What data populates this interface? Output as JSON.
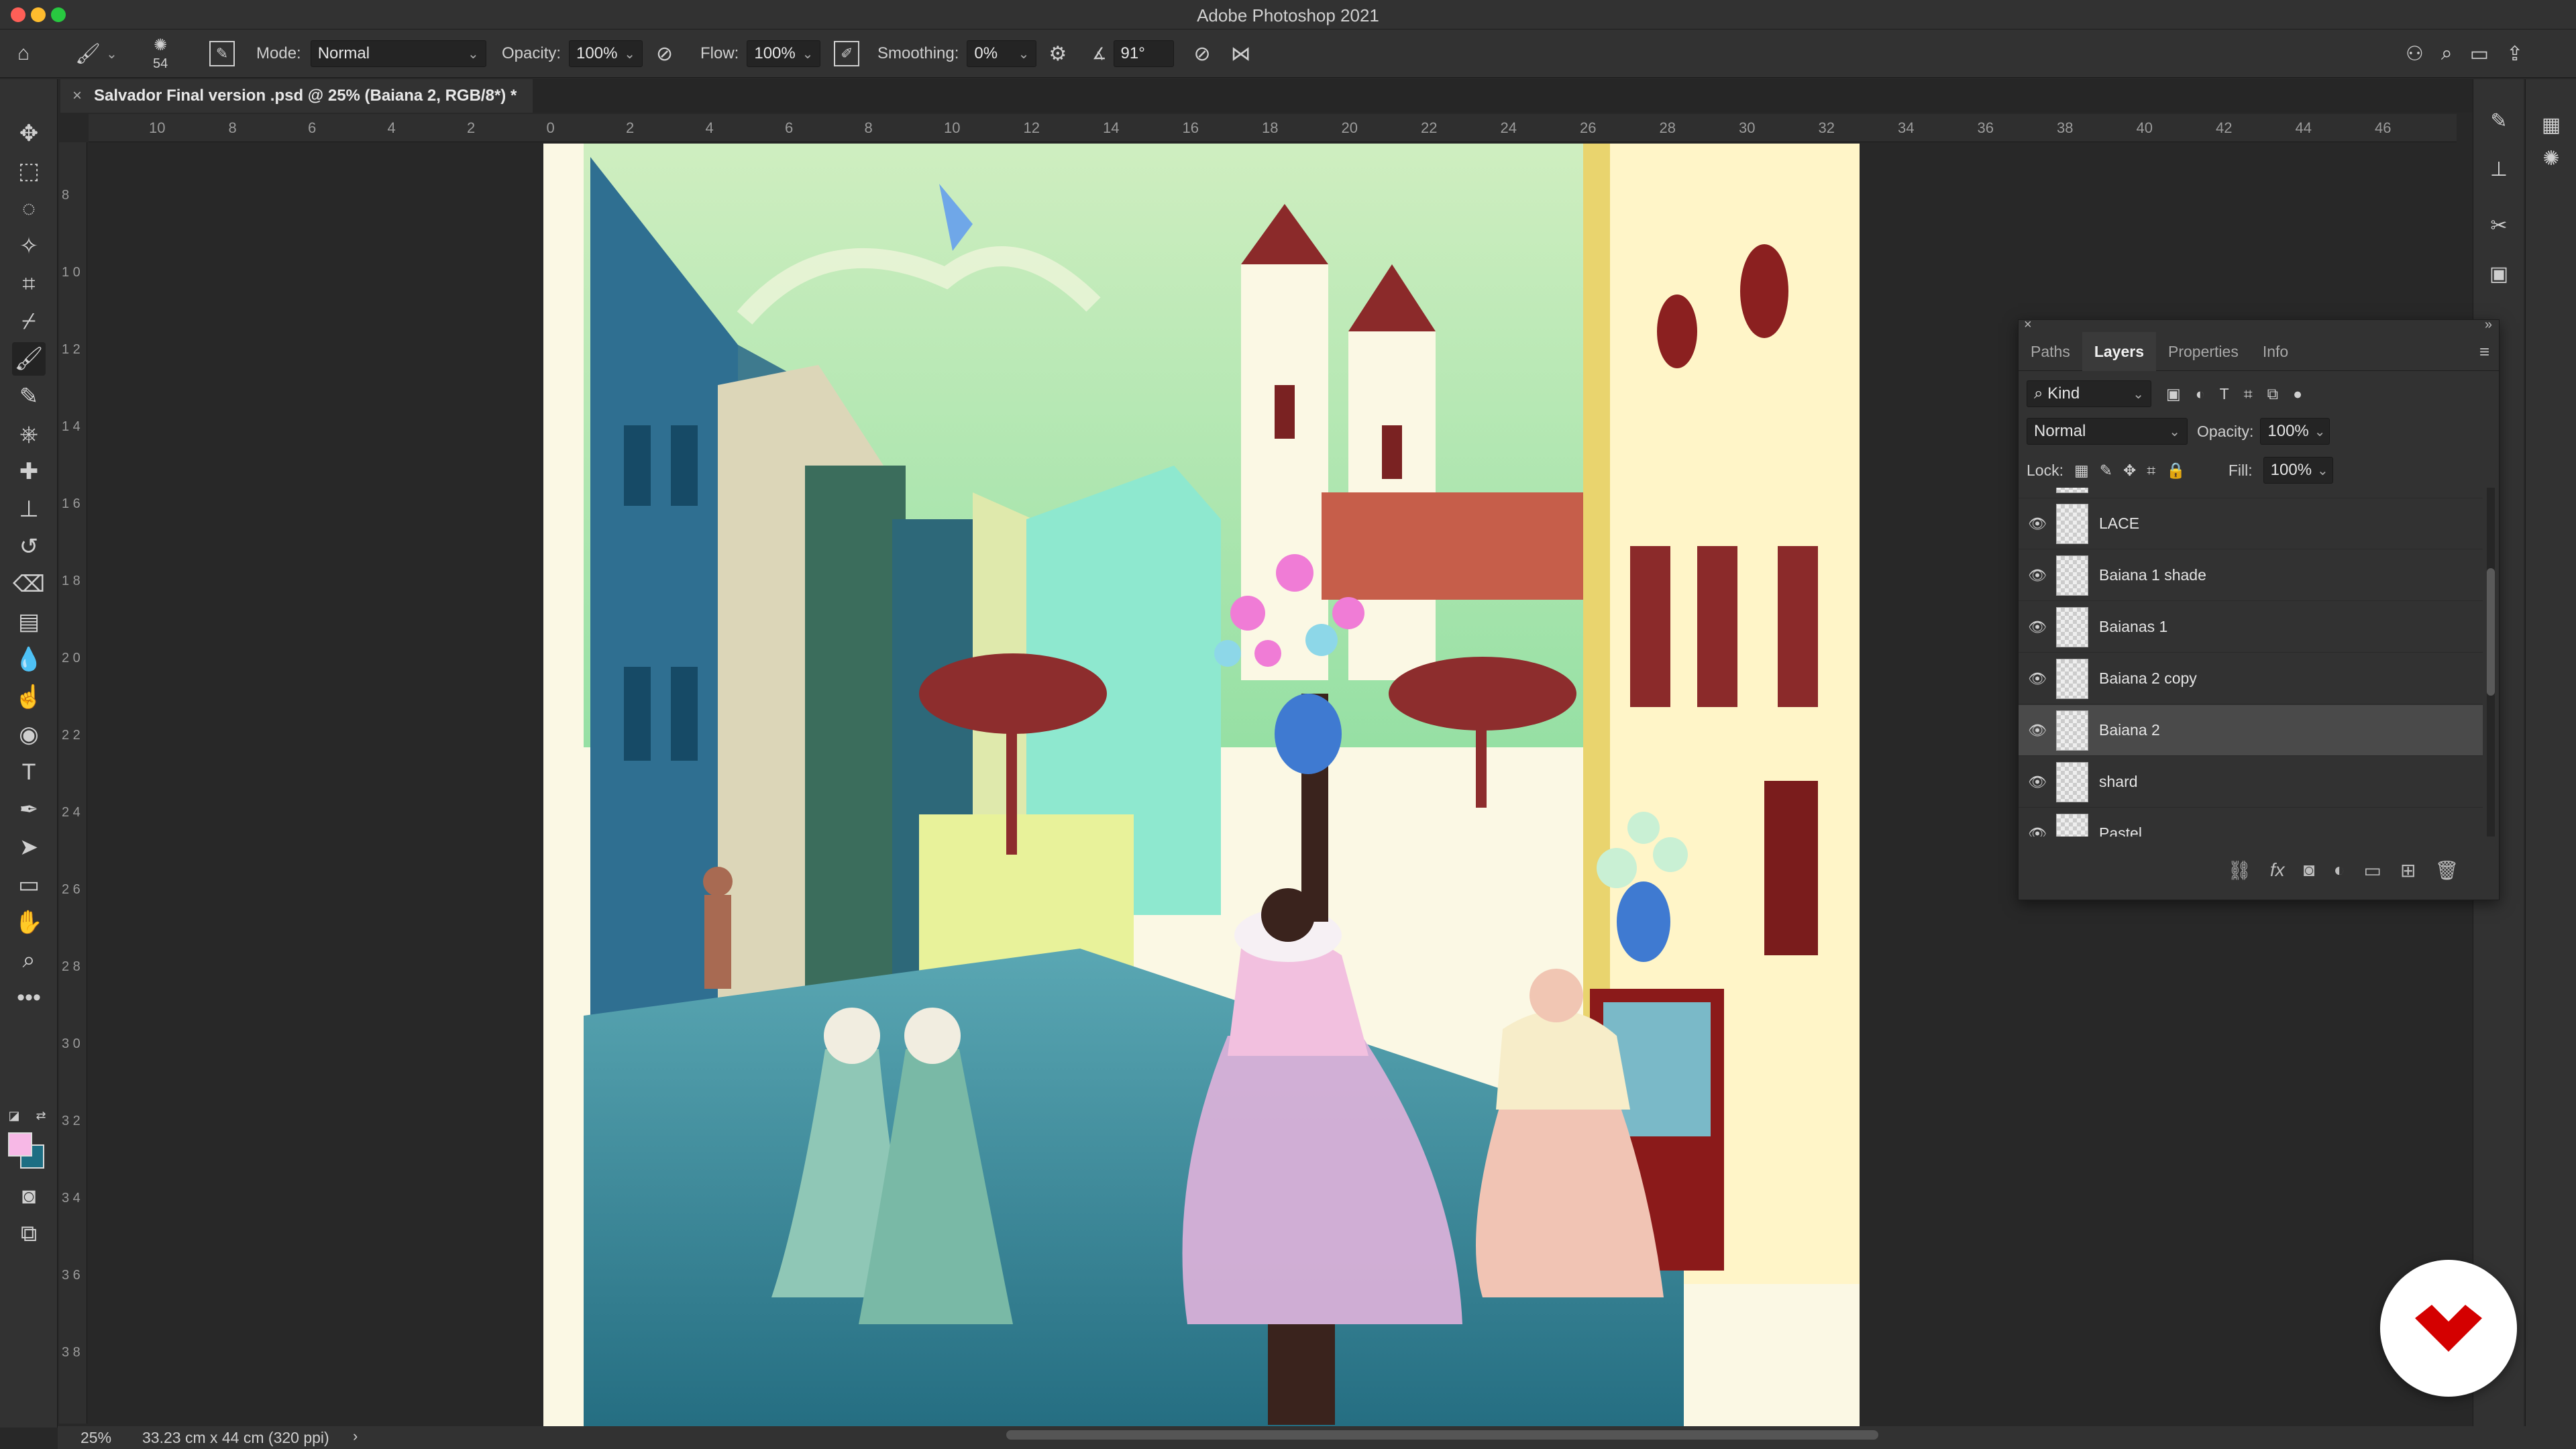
{
  "app": {
    "title": "Adobe Photoshop 2021"
  },
  "options_bar": {
    "brush_size": "54",
    "mode_label": "Mode:",
    "mode_value": "Normal",
    "opacity_label": "Opacity:",
    "opacity_value": "100%",
    "flow_label": "Flow:",
    "flow_value": "100%",
    "smoothing_label": "Smoothing:",
    "smoothing_value": "0%",
    "angle_value": "91°"
  },
  "document": {
    "tab_title": "Salvador Final version .psd @ 25% (Baiana 2, RGB/8*) *"
  },
  "rulers": {
    "horizontal": [
      "10",
      "8",
      "6",
      "4",
      "2",
      "0",
      "2",
      "4",
      "6",
      "8",
      "10",
      "12",
      "14",
      "16",
      "18",
      "20",
      "22",
      "24",
      "26",
      "28",
      "30",
      "32",
      "34",
      "36",
      "38",
      "40",
      "42",
      "44",
      "46"
    ],
    "vertical": [
      "8",
      "1 0",
      "1 2",
      "1 4",
      "1 6",
      "1 8",
      "2 0",
      "2 2",
      "2 4",
      "2 6",
      "2 8",
      "3 0",
      "3 2",
      "3 4",
      "3 6",
      "3 8"
    ]
  },
  "status": {
    "zoom": "25%",
    "doc_size": "33.23 cm x 44 cm (320 ppi)"
  },
  "layers_panel": {
    "tabs": [
      "Paths",
      "Layers",
      "Properties",
      "Info"
    ],
    "active_tab": "Layers",
    "filter_kind": "Kind",
    "blend_mode": "Normal",
    "opacity_label": "Opacity:",
    "opacity_value": "100%",
    "lock_label": "Lock:",
    "fill_label": "Fill:",
    "fill_value": "100%",
    "layers": [
      {
        "name": "LACE",
        "selected": false
      },
      {
        "name": "Baiana 1 shade",
        "selected": false
      },
      {
        "name": "Baianas 1",
        "selected": false
      },
      {
        "name": "Baiana 2 copy",
        "selected": false
      },
      {
        "name": "Baiana 2",
        "selected": true
      },
      {
        "name": "shard",
        "selected": false
      },
      {
        "name": "Pastel",
        "selected": false
      }
    ]
  },
  "colors": {
    "foreground": "#f7b8e6",
    "background": "#1d6e83",
    "badge_mark": "#d40000"
  },
  "icons": {
    "home": "home-icon",
    "brush": "brush-icon",
    "settings": "gear-icon",
    "search": "search-icon",
    "share": "share-icon"
  }
}
